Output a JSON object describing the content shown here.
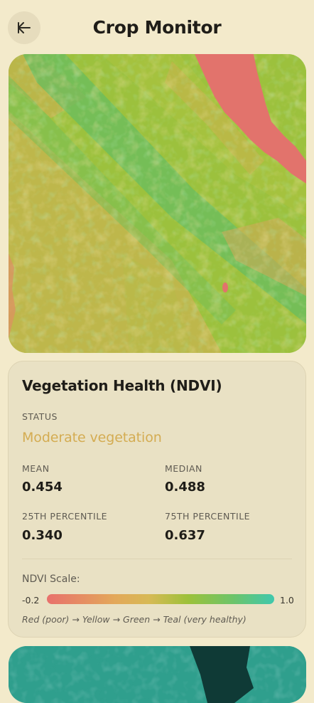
{
  "header": {
    "title": "Crop Monitor",
    "back_icon": "arrow-left-icon"
  },
  "ndvi_card": {
    "title": "Vegetation Health (NDVI)",
    "status_label": "STATUS",
    "status_value": "Moderate vegetation",
    "status_color": "#d4ac52",
    "stats": {
      "mean_label": "MEAN",
      "mean_value": "0.454",
      "median_label": "MEDIAN",
      "median_value": "0.488",
      "p25_label": "25TH PERCENTILE",
      "p25_value": "0.340",
      "p75_label": "75TH PERCENTILE",
      "p75_value": "0.637"
    },
    "scale": {
      "label": "NDVI Scale:",
      "min": "-0.2",
      "max": "1.0",
      "colors": [
        "#e8716c",
        "#e3a85a",
        "#d7b955",
        "#9dc13a",
        "#6cc46a",
        "#40c8ad"
      ],
      "legend": "Red (poor) → Yellow → Green → Teal (very healthy)"
    }
  },
  "colors": {
    "background": "#f3eacb",
    "card": "#e9e1c4",
    "water_red": "#e2736c",
    "teal": "#2f9f8d"
  }
}
